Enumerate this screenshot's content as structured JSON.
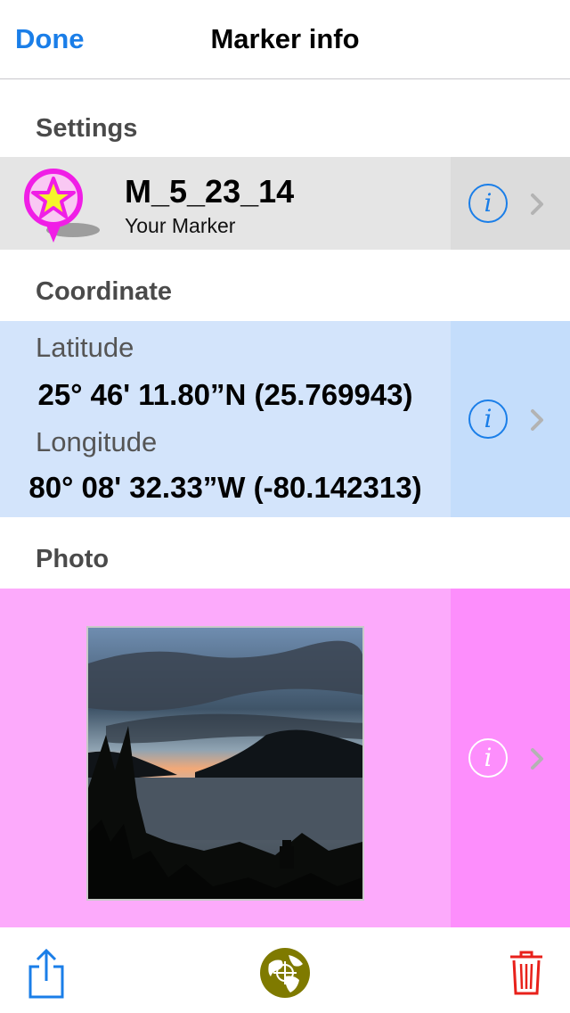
{
  "nav": {
    "done_label": "Done",
    "title": "Marker info"
  },
  "settings": {
    "header": "Settings",
    "marker_name": "M_5_23_14",
    "marker_subtitle": "Your Marker"
  },
  "coordinate": {
    "header": "Coordinate",
    "latitude_label": "Latitude",
    "latitude_value": "25° 46' 11.80”N (25.769943)",
    "longitude_label": "Longitude",
    "longitude_value": "80° 08' 32.33”W (-80.142313)"
  },
  "photo": {
    "header": "Photo"
  },
  "accessory": {
    "info_glyph": "i"
  },
  "colors": {
    "accent": "#1a7ee8",
    "settings_row": "#e5e5e5",
    "coord_row": "#d3e4fb",
    "photo_row": "#fcaafb",
    "marker_magenta": "#f01ee6",
    "globe": "#7f7a00",
    "trash": "#e8211b"
  },
  "toolbar": {
    "share_icon": "share-icon",
    "globe_icon": "globe-icon",
    "trash_icon": "trash-icon"
  }
}
